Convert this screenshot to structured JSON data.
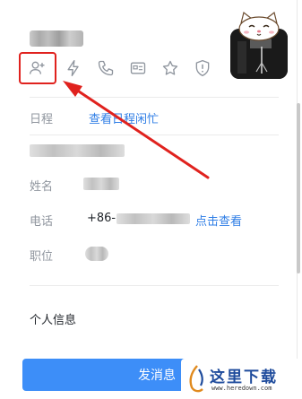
{
  "profile": {
    "icons": [
      "add-contact-icon",
      "lightning-icon",
      "phone-icon",
      "id-card-icon",
      "star-icon",
      "shield-alert-icon"
    ]
  },
  "details": {
    "schedule_label": "日程",
    "schedule_link": "查看日程闲忙",
    "name_label": "姓名",
    "phone_label": "电话",
    "phone_prefix": "+86-",
    "phone_link": "点击查看",
    "position_label": "职位"
  },
  "personal_info": {
    "title": "个人信息"
  },
  "actions": {
    "send_message_label": "发消息"
  },
  "watermark": {
    "text": "这里下载",
    "url": "www.heredown.com"
  },
  "colors": {
    "accent": "#3d8ef8",
    "link": "#2f7ee6",
    "highlight": "#e0221e"
  }
}
